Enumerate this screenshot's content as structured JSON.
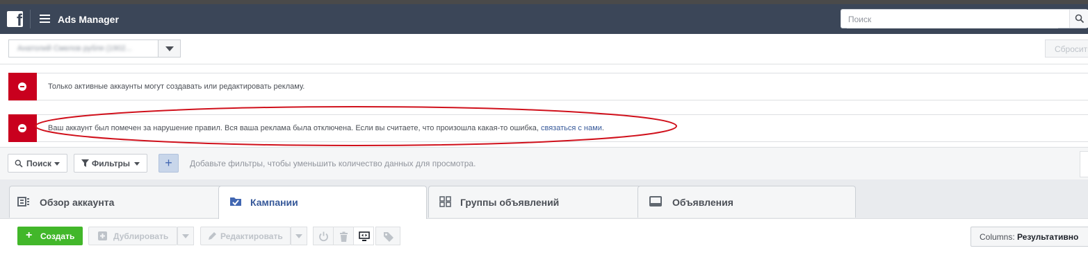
{
  "topbar": {
    "logo_letter": "f",
    "app_title": "Ads Manager",
    "search_placeholder": "Поиск",
    "bg_color": "#3b4658"
  },
  "account_row": {
    "account_name": "Анатолий Смелов рубля (1902...",
    "reset_label": "Сбросить"
  },
  "alerts": [
    {
      "text": "Только активные аккаунты могут создавать или редактировать рекламу."
    },
    {
      "text": "Ваш аккаунт был помечен за нарушение правил. Вся ваша реклама была отключена. Если вы считаете, что произошла какая-то ошибка, ",
      "link": "связаться с нами",
      "suffix": "."
    }
  ],
  "alert_color": "#c9001e",
  "filter_bar": {
    "search_label": "Поиск",
    "filters_label": "Фильтры",
    "add_label": "+",
    "hint": "Добавьте фильтры, чтобы уменьшить количество данных для просмотра."
  },
  "tabs": [
    {
      "label": "Обзор аккаунта",
      "icon": "account-overview-icon",
      "active": false
    },
    {
      "label": "Кампании",
      "icon": "campaigns-folder-icon",
      "active": true
    },
    {
      "label": "Группы объявлений",
      "icon": "ad-sets-grid-icon",
      "active": false
    },
    {
      "label": "Объявления",
      "icon": "ads-monitor-icon",
      "active": false
    }
  ],
  "toolbar": {
    "create_label": "Создать",
    "duplicate_label": "Дублировать",
    "edit_label": "Редактировать",
    "columns_prefix": "Columns: ",
    "columns_value": "Результативно",
    "create_color": "#42b72a"
  }
}
